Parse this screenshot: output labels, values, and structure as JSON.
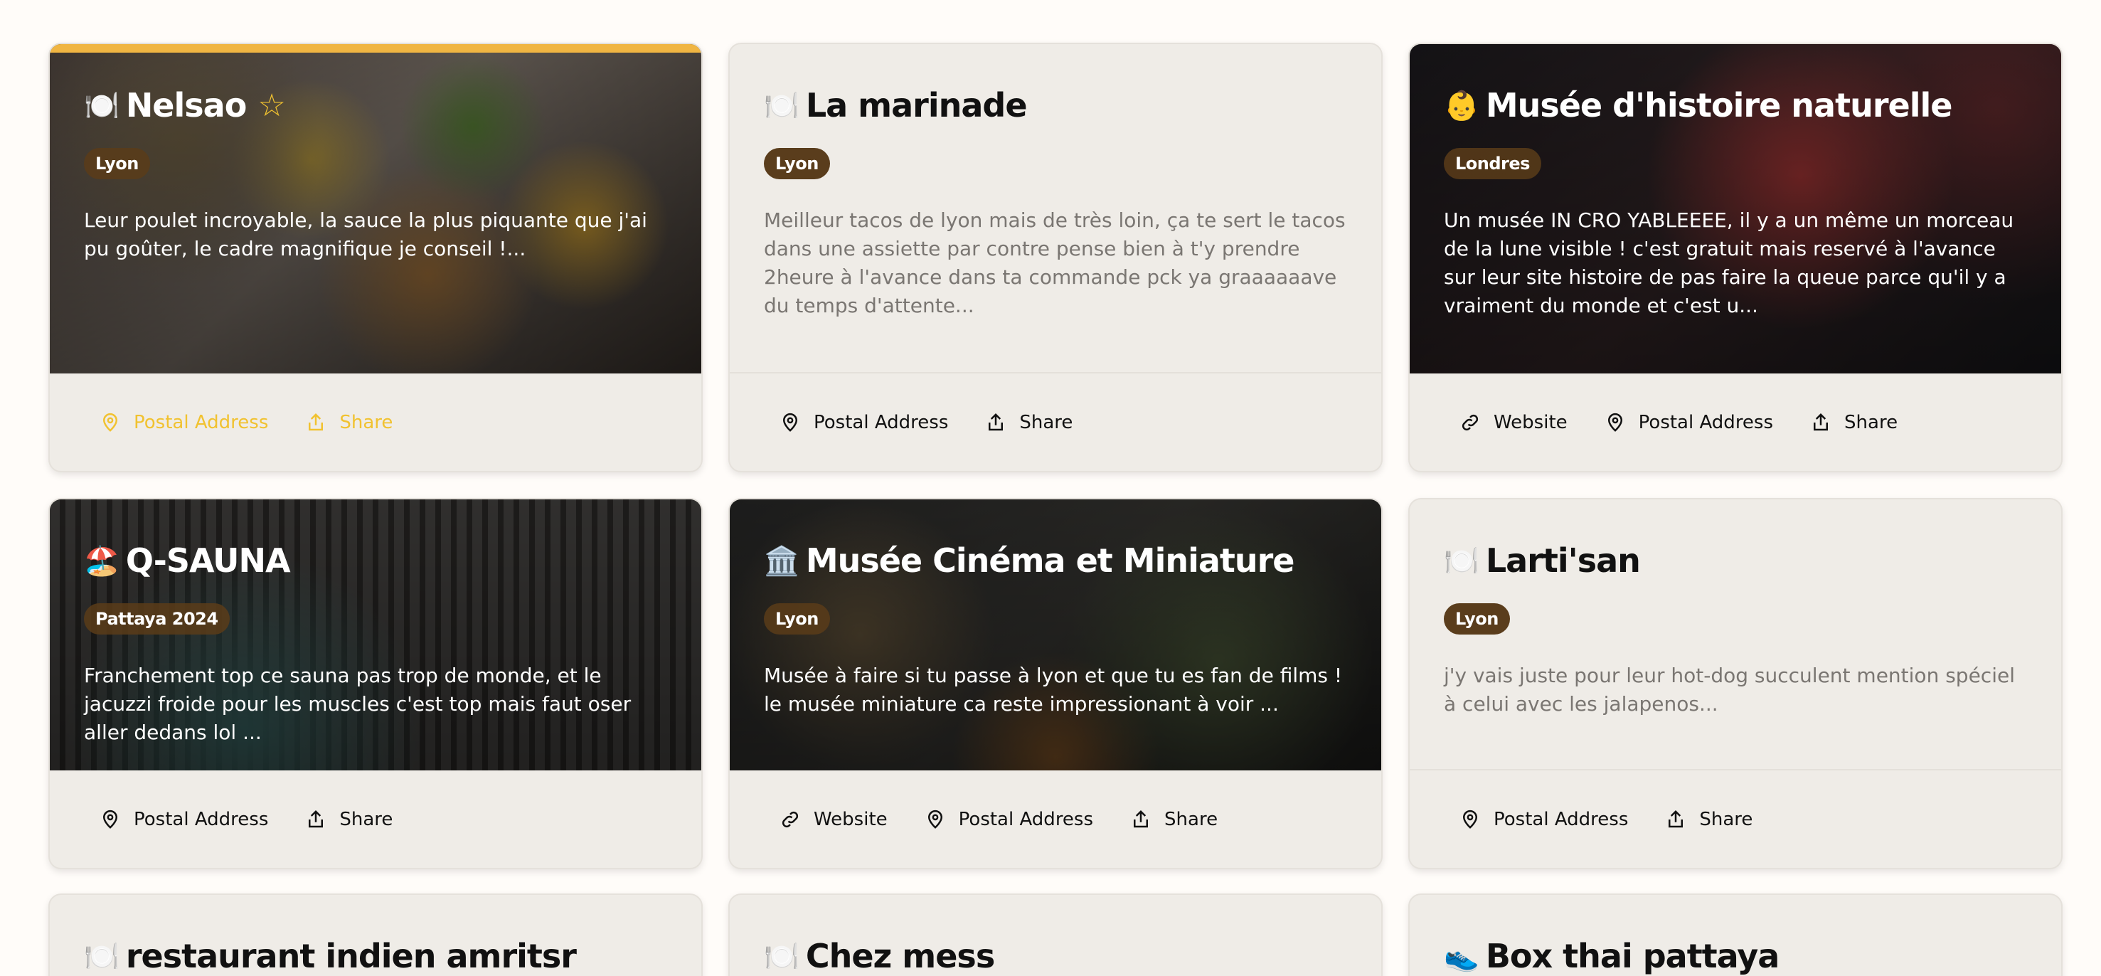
{
  "colors": {
    "page_bg": "#fffcf9",
    "card_bg": "#efece7",
    "badge_bg": "#5a3d1c",
    "favorite_gold": "#f1c230",
    "accent_bar": "#f0b542"
  },
  "cards": [
    {
      "emoji": "🍽️",
      "title": "Nelsao",
      "favorite": true,
      "badge": "Lyon",
      "description": "Leur poulet incroyable, la sauce la plus piquante que j'ai pu goûter, le cadre magnifique je conseil !...",
      "actions": [
        "Postal Address",
        "Share"
      ]
    },
    {
      "emoji": "🍽️",
      "title": "La marinade",
      "badge": "Lyon",
      "description": "Meilleur tacos de lyon mais de très loin, ça te sert le tacos dans une assiette par contre pense bien à t'y prendre 2heure à l'avance dans ta commande pck ya graaaaaave du temps d'attente...",
      "actions": [
        "Postal Address",
        "Share"
      ]
    },
    {
      "emoji": "👶",
      "title": "Musée d'histoire naturelle",
      "badge": "Londres",
      "description": "Un musée IN CRO YABLEEEE, il y a un même un morceau de la lune visible ! c'est gratuit mais reservé à l'avance sur leur site histoire de pas faire la queue parce qu'il y a vraiment du monde et c'est u...",
      "actions": [
        "Website",
        "Postal Address",
        "Share"
      ]
    },
    {
      "emoji": "🏖️",
      "title": "Q-SAUNA",
      "badge": "Pattaya 2024",
      "description": "Franchement top ce sauna pas trop de monde, et le jacuzzi froide pour les muscles c'est top mais faut oser aller dedans lol ...",
      "actions": [
        "Postal Address",
        "Share"
      ]
    },
    {
      "emoji": "🏛️",
      "title": "Musée Cinéma et Miniature",
      "badge": "Lyon",
      "description": "Musée à faire si tu passe à lyon et que tu es fan de films ! le musée miniature ca reste impressionant à voir ...",
      "actions": [
        "Website",
        "Postal Address",
        "Share"
      ]
    },
    {
      "emoji": "🍽️",
      "title": "Larti'san",
      "badge": "Lyon",
      "description": "j'y vais juste pour leur hot-dog succulent mention spéciel à celui avec les jalapenos...",
      "actions": [
        "Postal Address",
        "Share"
      ]
    },
    {
      "emoji": "🍽️",
      "title": "restaurant indien amritsr"
    },
    {
      "emoji": "🍽️",
      "title": "Chez mess"
    },
    {
      "emoji": "👟",
      "title": "Box thai pattaya"
    }
  ]
}
